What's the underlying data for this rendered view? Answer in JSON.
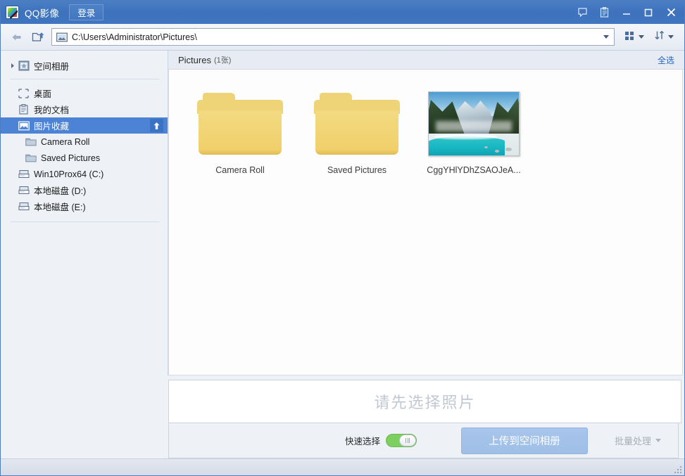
{
  "window": {
    "title": "QQ影像",
    "login_label": "登录",
    "buttons": {
      "feedback": "feedback-icon",
      "notes": "clipboard-icon",
      "minimize": "minimize-icon",
      "maximize": "maximize-icon",
      "close": "close-icon"
    }
  },
  "nav": {
    "back_icon": "back-arrow-icon",
    "up_icon": "open-folder-up-icon",
    "address_value": "C:\\Users\\Administrator\\Pictures\\",
    "address_placeholder": "C:\\Users\\Administrator\\Pictures\\",
    "view_icon": "grid-view-icon",
    "sort_icon": "sort-icon"
  },
  "sidebar": {
    "album": {
      "label": "空间相册",
      "icon": "star-album-icon"
    },
    "items": [
      {
        "label": "桌面",
        "icon": "desktop-icon",
        "indent": false,
        "selected": false
      },
      {
        "label": "我的文档",
        "icon": "documents-icon",
        "indent": false,
        "selected": false
      },
      {
        "label": "图片收藏",
        "icon": "pictures-icon",
        "indent": false,
        "selected": true,
        "action_icon": "upload-arrow-icon"
      },
      {
        "label": "Camera Roll",
        "icon": "folder-icon",
        "indent": true,
        "selected": false
      },
      {
        "label": "Saved Pictures",
        "icon": "folder-icon",
        "indent": true,
        "selected": false
      },
      {
        "label": "Win10Prox64 (C:)",
        "icon": "drive-icon",
        "indent": false,
        "selected": false
      },
      {
        "label": "本地磁盘 (D:)",
        "icon": "drive-icon",
        "indent": false,
        "selected": false
      },
      {
        "label": "本地磁盘 (E:)",
        "icon": "drive-icon",
        "indent": false,
        "selected": false
      }
    ]
  },
  "content": {
    "header_title": "Pictures",
    "header_count": "(1张)",
    "select_all": "全选",
    "tiles": [
      {
        "caption": "Camera Roll",
        "kind": "folder"
      },
      {
        "caption": "Saved Pictures",
        "kind": "folder"
      },
      {
        "caption": "CggYHlYDhZSAOJeA...",
        "kind": "photo"
      }
    ]
  },
  "bottom": {
    "dropzone_text": "请先选择照片",
    "quick_select_label": "快速选择",
    "quick_select_on": true,
    "upload_label": "上传到空间相册",
    "batch_label": "批量处理"
  },
  "colors": {
    "titlebar": "#4075bf",
    "accent_selected": "#4c83d4",
    "link": "#2a63b8",
    "toggle_on": "#7dd05f",
    "upload_disabled": "#a2c2e8"
  }
}
